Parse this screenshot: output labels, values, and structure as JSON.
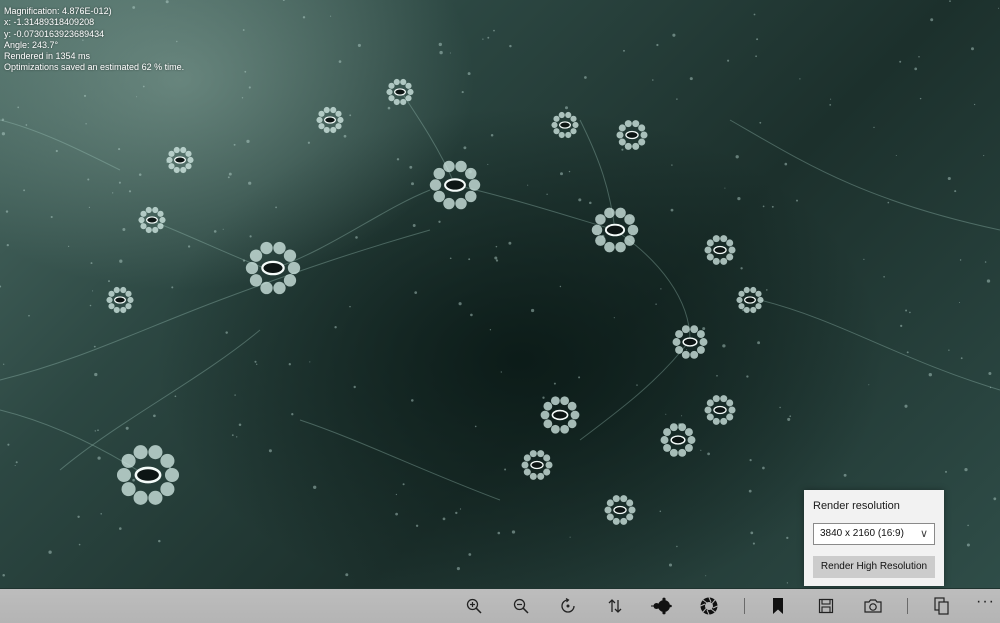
{
  "info": {
    "magnification": "Magnification: 4.876E-012)",
    "x": "x: -1.31489318409208",
    "y": "y: -0.0730163923689434",
    "angle": "Angle: 243.7°",
    "rendered": "Rendered in 1354 ms",
    "optimizations": "Optimizations saved an estimated 62 % time."
  },
  "render_panel": {
    "title": "Render resolution",
    "selected_resolution": "3840 x 2160 (16:9)",
    "render_button": "Render High Resolution"
  },
  "toolbar": {
    "icons": [
      "zoom-in-icon",
      "zoom-out-icon",
      "rotate-icon",
      "swap-icon",
      "mandelbrot-icon",
      "aperture-icon",
      "bookmark-icon",
      "save-icon",
      "camera-icon",
      "copy-icon",
      "more-icon"
    ],
    "more_label": "···"
  },
  "colors": {
    "fractal_dark": "#1c302c",
    "fractal_light": "#4d6d66",
    "toolbar_bg": "#b8b8b8",
    "panel_bg": "#f2f2f2"
  }
}
